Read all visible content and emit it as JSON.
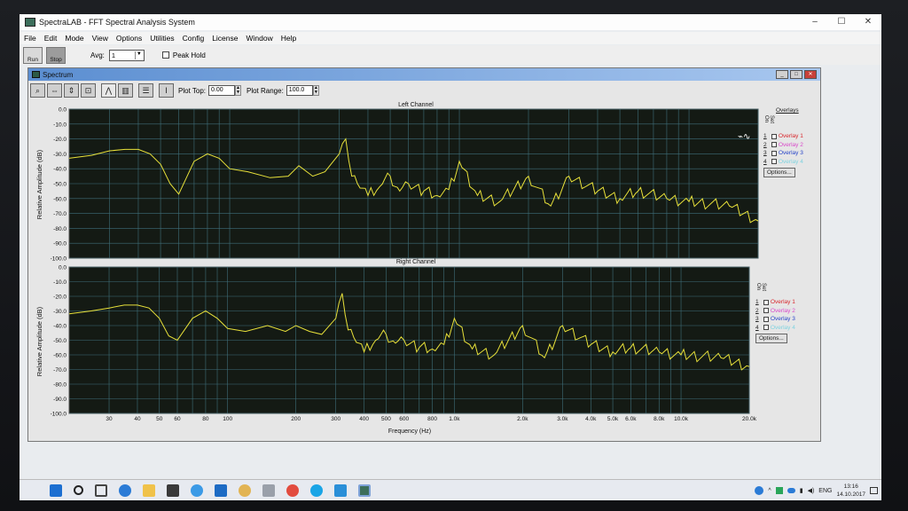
{
  "window": {
    "title": "SpectraLAB - FFT Spectral Analysis System"
  },
  "menu": [
    "File",
    "Edit",
    "Mode",
    "View",
    "Options",
    "Utilities",
    "Config",
    "License",
    "Window",
    "Help"
  ],
  "toolbar": {
    "run_label": "Run",
    "stop_label": "Stop",
    "avg_label": "Avg:",
    "avg_value": "1",
    "peak_hold_label": "Peak Hold"
  },
  "spectrum": {
    "title": "Spectrum",
    "plot_top_label": "Plot Top:",
    "plot_top_value": "0.00",
    "plot_range_label": "Plot Range:",
    "plot_range_value": "100.0",
    "left_title": "Left Channel",
    "right_title": "Right Channel",
    "y_axis_label": "Relative Amplitude (dB)",
    "x_axis_label": "Frequency (Hz)",
    "overlays_title": "Overlays",
    "set_label": "Set",
    "on_label": "On",
    "overlays": [
      "Overlay 1",
      "Overlay 2",
      "Overlay 3",
      "Overlay 4"
    ],
    "overlay_colors": [
      "#d8262b",
      "#d849c9",
      "#2744c8",
      "#7fd3e0"
    ],
    "options_label": "Options..."
  },
  "chart_data": [
    {
      "type": "line",
      "title": "Left Channel",
      "xlabel": "Frequency (Hz)",
      "ylabel": "Relative Amplitude (dB)",
      "x_scale": "log",
      "xlim": [
        20,
        20000
      ],
      "ylim": [
        -100,
        0
      ],
      "grid": true,
      "line_color": "#e8e13a",
      "y_ticks": [
        "0.0",
        "-10.0",
        "-20.0",
        "-30.0",
        "-40.0",
        "-50.0",
        "-60.0",
        "-70.0",
        "-80.0",
        "-90.0",
        "-100.0"
      ],
      "x": [
        20,
        25,
        30,
        35,
        40,
        45,
        50,
        55,
        60,
        70,
        80,
        90,
        100,
        120,
        150,
        180,
        200,
        230,
        260,
        300,
        320,
        340,
        360,
        400,
        450,
        500,
        550,
        600,
        700,
        800,
        900,
        1000,
        1200,
        1500,
        2000,
        2500,
        3000,
        4000,
        5000,
        6000,
        8000,
        10000,
        15000,
        20000
      ],
      "y": [
        -33,
        -31,
        -28,
        -27,
        -27,
        -30,
        -37,
        -50,
        -57,
        -35,
        -30,
        -33,
        -40,
        -42,
        -46,
        -45,
        -38,
        -45,
        -42,
        -30,
        -20,
        -45,
        -50,
        -58,
        -52,
        -45,
        -55,
        -50,
        -55,
        -58,
        -54,
        -35,
        -58,
        -62,
        -45,
        -65,
        -45,
        -55,
        -60,
        -55,
        -60,
        -62,
        -65,
        -75
      ]
    },
    {
      "type": "line",
      "title": "Right Channel",
      "xlabel": "Frequency (Hz)",
      "ylabel": "Relative Amplitude (dB)",
      "x_scale": "log",
      "xlim": [
        20,
        20000
      ],
      "ylim": [
        -100,
        0
      ],
      "grid": true,
      "line_color": "#e8e13a",
      "y_ticks": [
        "0.0",
        "-10.0",
        "-20.0",
        "-30.0",
        "-40.0",
        "-50.0",
        "-60.0",
        "-70.0",
        "-80.0",
        "-90.0",
        "-100.0"
      ],
      "x_ticks": [
        "30",
        "40",
        "50",
        "60",
        "80",
        "100",
        "200",
        "300",
        "400",
        "500",
        "600",
        "800",
        "1.0k",
        "2.0k",
        "3.0k",
        "4.0k",
        "5.0k",
        "6.0k",
        "8.0k",
        "10.0k",
        "20.0k"
      ],
      "x": [
        20,
        25,
        30,
        35,
        40,
        45,
        50,
        55,
        60,
        70,
        80,
        90,
        100,
        120,
        150,
        180,
        200,
        230,
        260,
        300,
        320,
        340,
        360,
        400,
        450,
        500,
        550,
        600,
        700,
        800,
        900,
        1000,
        1200,
        1500,
        2000,
        2500,
        3000,
        4000,
        5000,
        6000,
        8000,
        10000,
        15000,
        20000
      ],
      "y": [
        -32,
        -30,
        -28,
        -26,
        -26,
        -28,
        -35,
        -47,
        -50,
        -35,
        -30,
        -35,
        -42,
        -44,
        -40,
        -44,
        -40,
        -44,
        -46,
        -35,
        -18,
        -43,
        -48,
        -58,
        -50,
        -46,
        -52,
        -50,
        -55,
        -56,
        -53,
        -35,
        -56,
        -60,
        -40,
        -62,
        -40,
        -53,
        -58,
        -55,
        -58,
        -60,
        -62,
        -68
      ]
    }
  ],
  "taskbar": {
    "lang": "ENG",
    "time": "13:16",
    "date": "14.10.2017"
  }
}
